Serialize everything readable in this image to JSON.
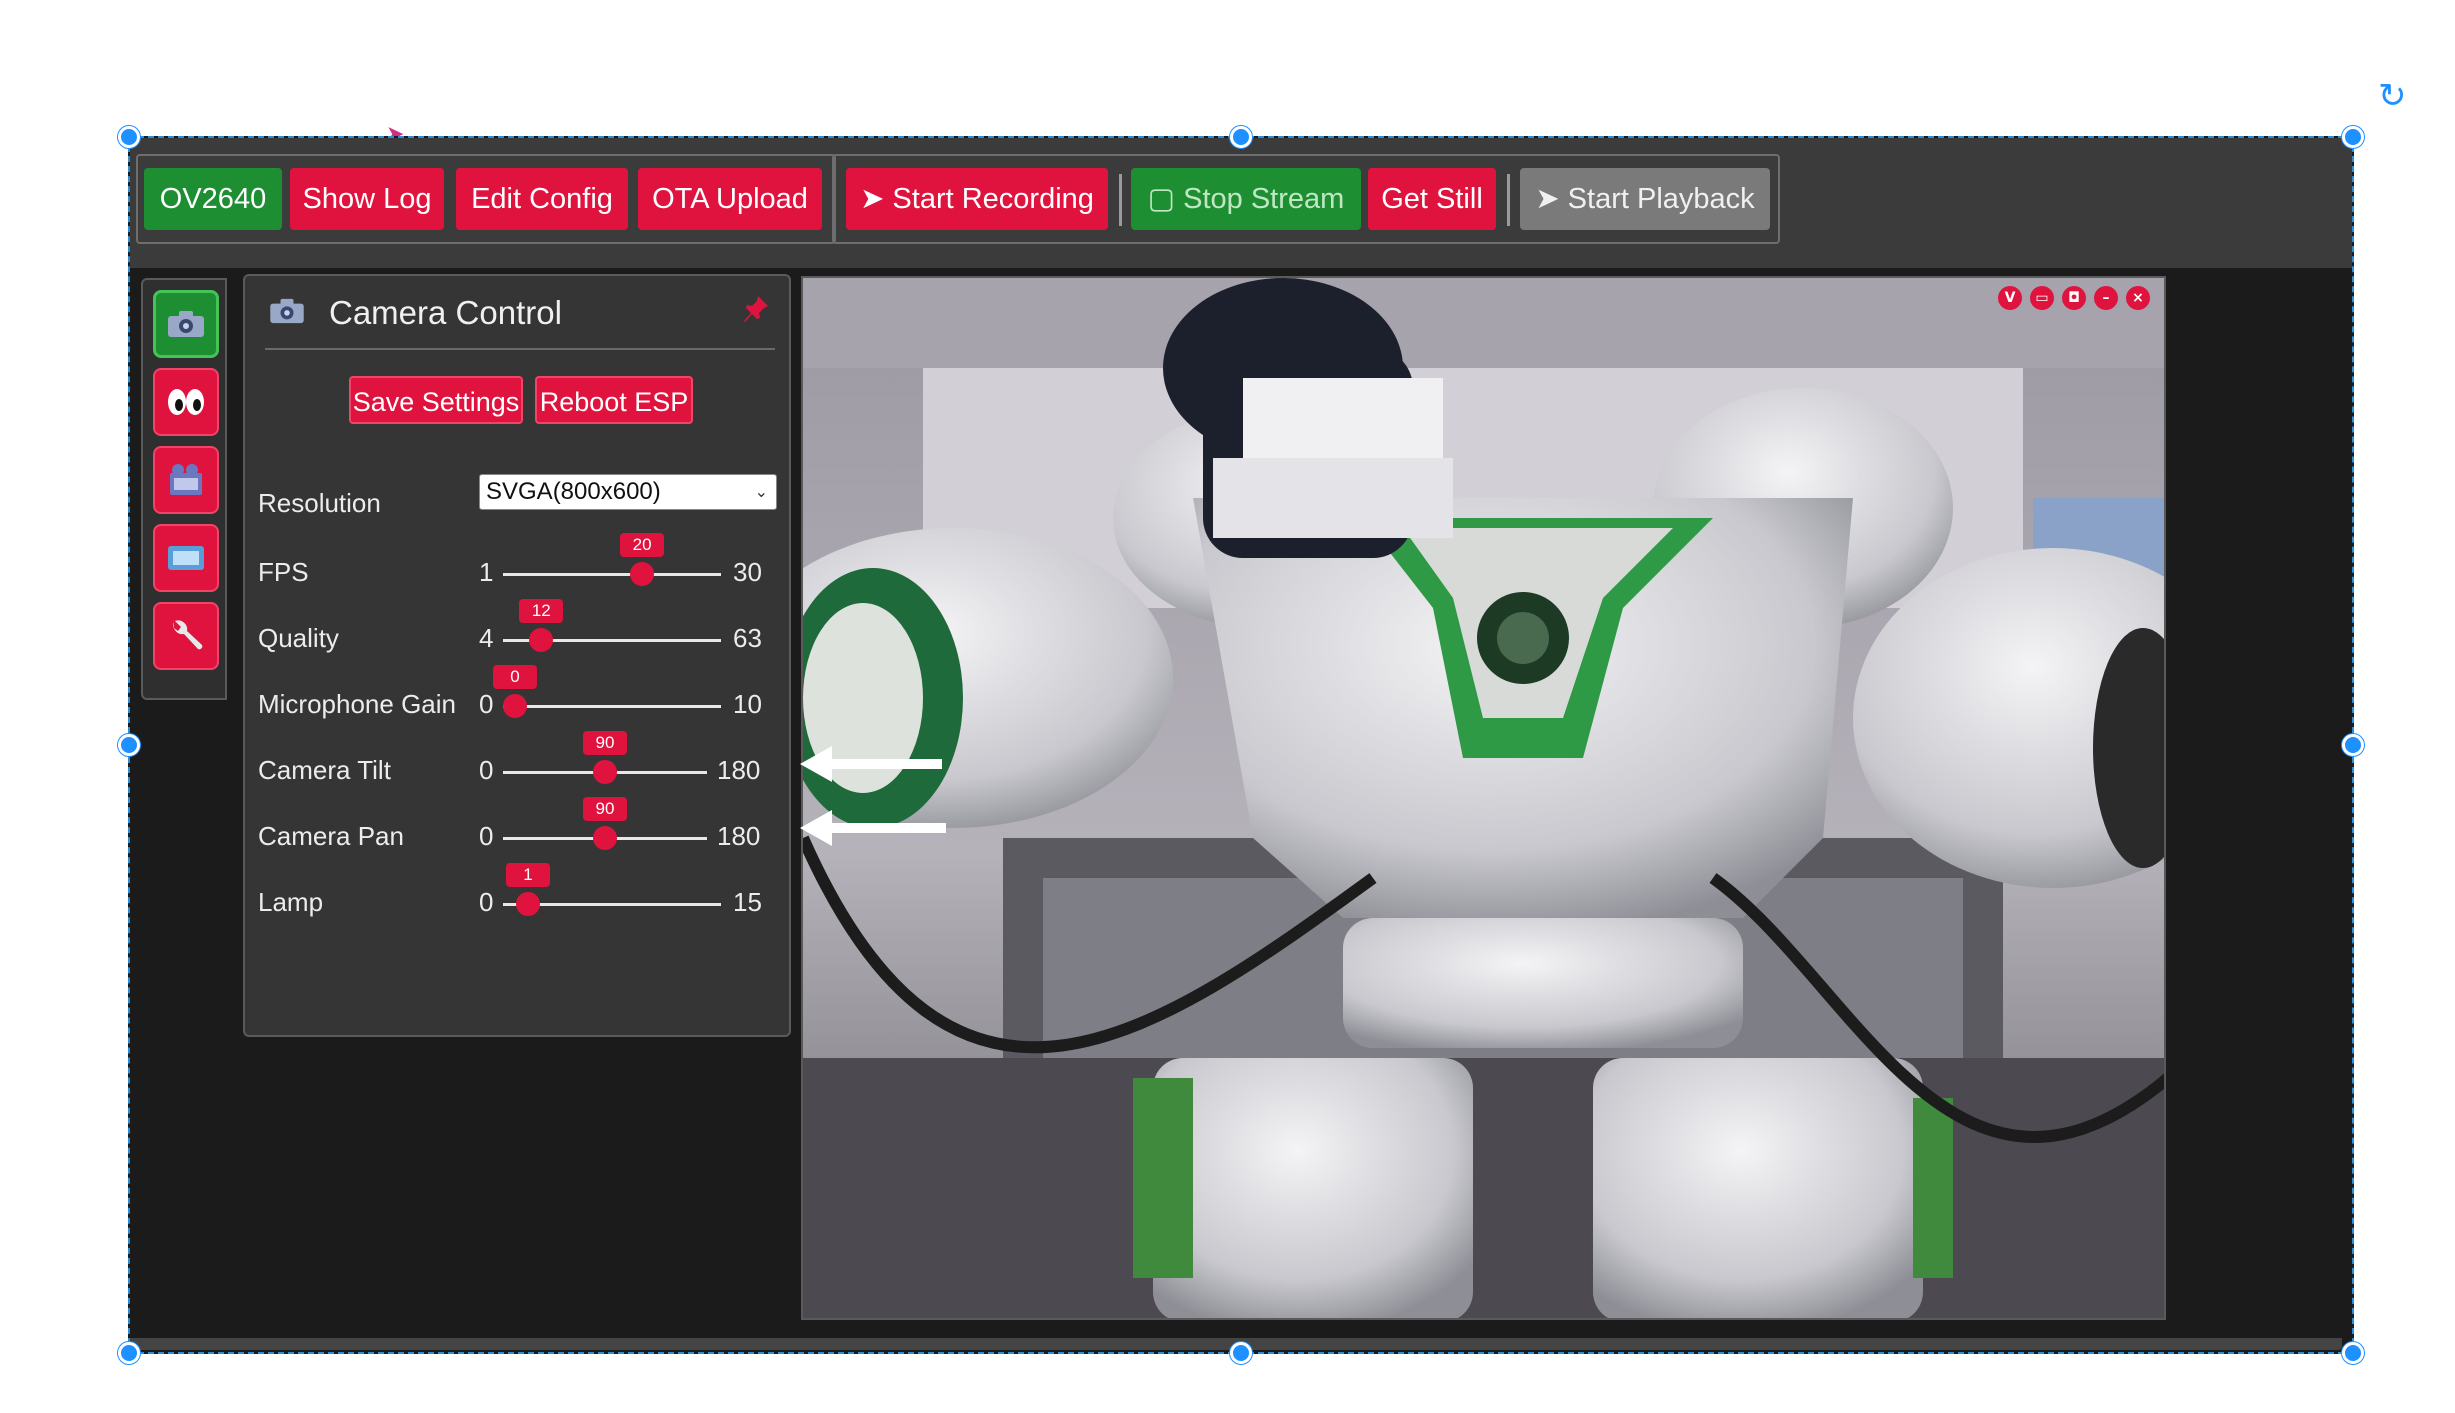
{
  "toolbar": {
    "camera_model": "OV2640",
    "show_log": "Show Log",
    "edit_config": "Edit Config",
    "ota_upload": "OTA Upload",
    "start_recording": "➤ Start Recording",
    "stop_stream": "▢ Stop Stream",
    "get_still": "Get Still",
    "start_playback": "➤ Start Playback"
  },
  "side_icons": [
    "camera-icon",
    "eyes-icon",
    "film-icon",
    "monitor-icon",
    "wrench-icon"
  ],
  "panel": {
    "title": "Camera Control",
    "save_settings": "Save Settings",
    "reboot_esp": "Reboot ESP",
    "resolution": {
      "label": "Resolution",
      "value": "SVGA(800x600)"
    },
    "sliders": [
      {
        "label": "FPS",
        "min": "1",
        "max": "30",
        "value": "20"
      },
      {
        "label": "Quality",
        "min": "4",
        "max": "63",
        "value": "12"
      },
      {
        "label": "Microphone Gain",
        "min": "0",
        "max": "10",
        "value": "0"
      },
      {
        "label": "Camera Tilt",
        "min": "0",
        "max": "180",
        "value": "90"
      },
      {
        "label": "Camera Pan",
        "min": "0",
        "max": "180",
        "value": "90"
      },
      {
        "label": "Lamp",
        "min": "0",
        "max": "15",
        "value": "1"
      }
    ]
  },
  "video": {
    "controls": [
      "V",
      "▭",
      "◘",
      "–",
      "×"
    ]
  },
  "colors": {
    "accent_red": "#e0133f",
    "accent_green": "#1e8e32",
    "selection_blue": "#1e90ff"
  }
}
